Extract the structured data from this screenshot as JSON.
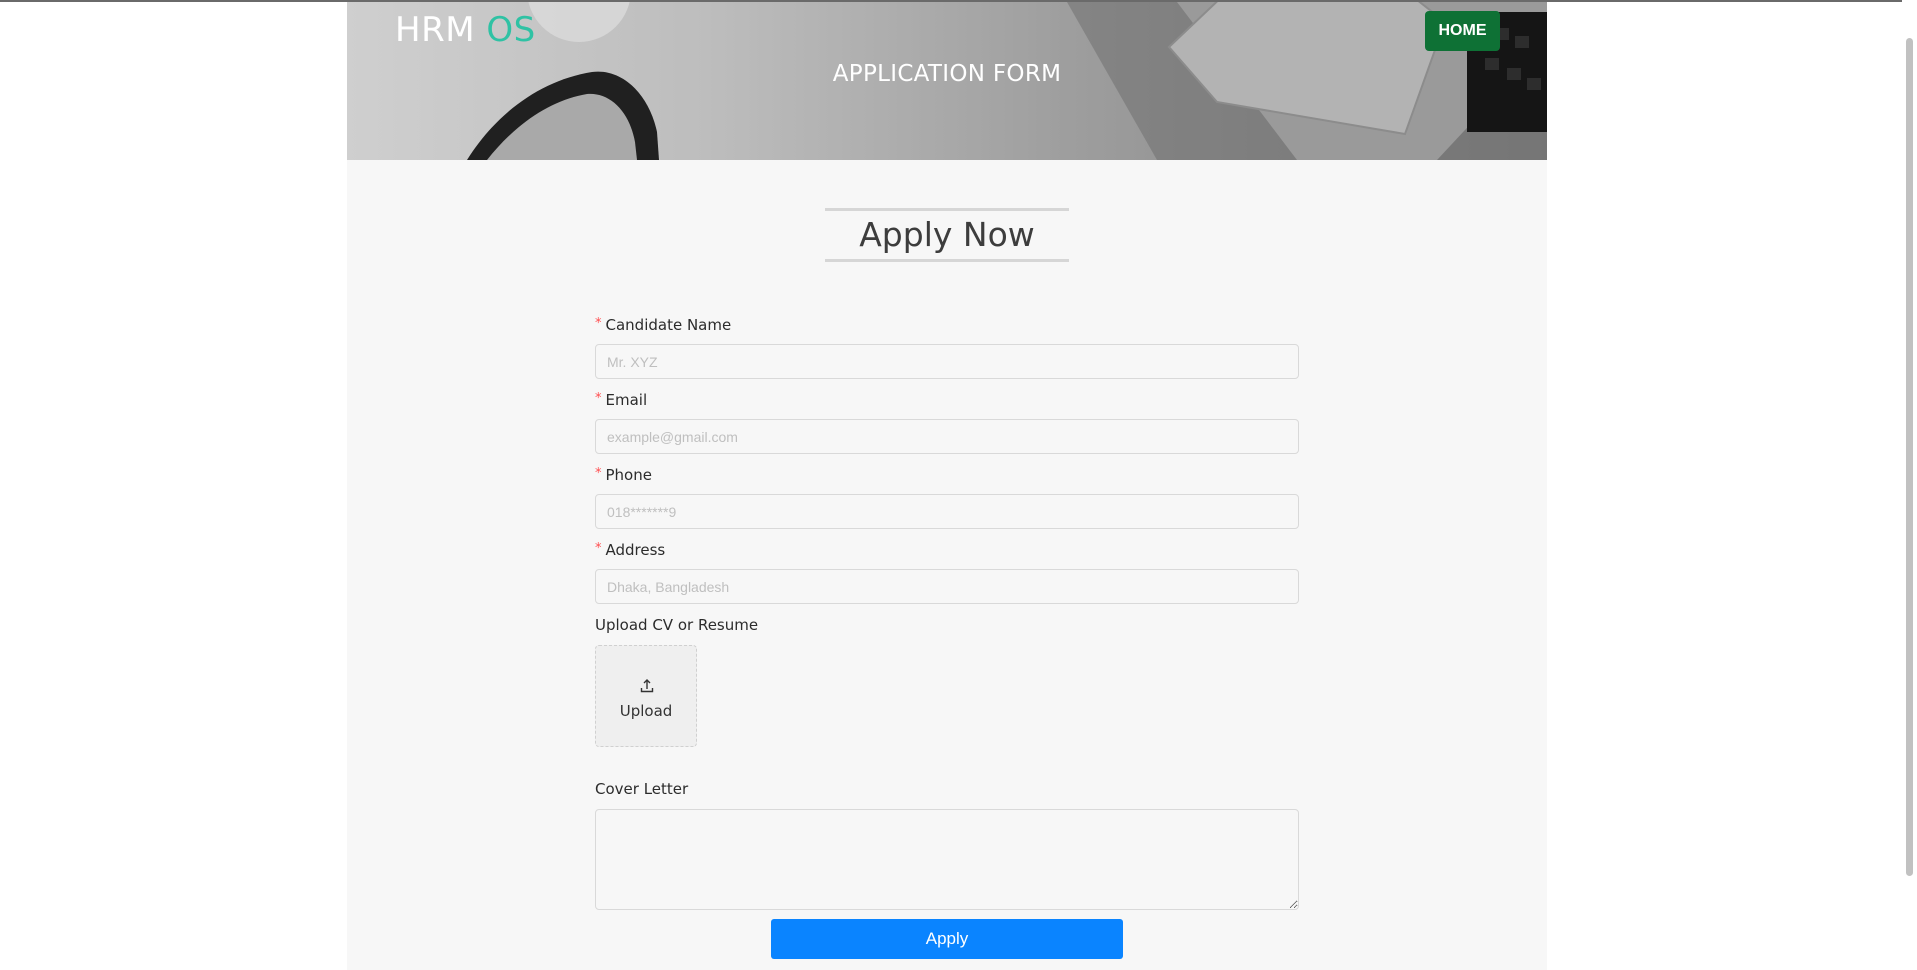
{
  "header": {
    "brand_main": "HRM ",
    "brand_accent": "OS",
    "title": "APPLICATION FORM",
    "home_label": "HOME"
  },
  "heading": "Apply Now",
  "form": {
    "candidate_name": {
      "label": "Candidate Name",
      "placeholder": "Mr. XYZ",
      "required": true
    },
    "email": {
      "label": "Email",
      "placeholder": "example@gmail.com",
      "required": true
    },
    "phone": {
      "label": "Phone",
      "placeholder": "018*******9",
      "required": true
    },
    "address": {
      "label": "Address",
      "placeholder": "Dhaka, Bangladesh",
      "required": true
    },
    "upload": {
      "label": "Upload CV or Resume",
      "button_label": "Upload",
      "icon": "upload-icon"
    },
    "cover_letter": {
      "label": "Cover Letter",
      "value": ""
    },
    "required_mark": "*",
    "submit_label": "Apply"
  },
  "colors": {
    "brand_accent": "#2fc2a4",
    "home_button": "#0e7135",
    "apply_button": "#0a84ff",
    "required": "#ff4d4f"
  }
}
